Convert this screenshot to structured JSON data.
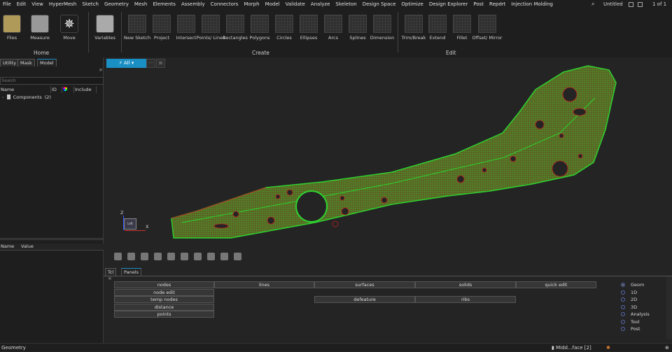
{
  "menu": [
    "File",
    "Edit",
    "View",
    "HyperMesh",
    "Sketch",
    "Geometry",
    "Mesh",
    "Elements",
    "Assembly",
    "Connectors",
    "Morph",
    "Model",
    "Validate",
    "Analyze",
    "Skeleton",
    "Design Space",
    "Optimize",
    "Design Explorer",
    "Post",
    "Report",
    "Injection Molding"
  ],
  "menu_active": "Sketch",
  "topright": {
    "doc": "Untitled",
    "page": "1 of 1"
  },
  "ribbon": {
    "home": {
      "files": "Files",
      "measure": "Measure",
      "move": "Move",
      "group": "Home"
    },
    "variables": "Variables",
    "create": {
      "items": [
        "New Sketch",
        "Project",
        "Intersect",
        "Points/ Lines",
        "Rectangles",
        "Polygons",
        "Circles",
        "Ellipses",
        "Arcs",
        "Splines",
        "Dimension"
      ],
      "group": "Create"
    },
    "edit": {
      "items": [
        "Trim/Break",
        "Extend",
        "Fillet",
        "Offset/ Mirror"
      ],
      "group": "Edit"
    }
  },
  "left": {
    "tabs": [
      "Utility",
      "Mask",
      "Model"
    ],
    "search_placeholder": "Search",
    "columns": [
      "Name",
      "ID",
      "",
      "Include"
    ],
    "tree": [
      {
        "label": "Components",
        "count": "(2)"
      }
    ],
    "props_columns": [
      "Name",
      "Value"
    ]
  },
  "filter": {
    "label": "All"
  },
  "axes": {
    "z": "Z",
    "x": "X",
    "cube": "Left"
  },
  "bottom": {
    "tabs": [
      "Tcl",
      "Panels"
    ],
    "panels": [
      [
        "nodes",
        "lines",
        "surfaces",
        "solids",
        "quick edit"
      ],
      [
        "node edit",
        "",
        "",
        "",
        ""
      ],
      [
        "temp nodes",
        "",
        "defeature",
        "ribs",
        ""
      ],
      [
        "distance",
        "",
        "",
        "",
        ""
      ],
      [
        "points",
        "",
        "",
        "",
        ""
      ]
    ],
    "radios": [
      "Geom",
      "1D",
      "2D",
      "3D",
      "Analysis",
      "Tool",
      "Post"
    ],
    "radio_selected": "Geom"
  },
  "status": {
    "left": "Geometry",
    "component": "Midd...face [2]"
  },
  "colors": {
    "accent": "#1a8fc4",
    "mesh_green": "#2fd12f",
    "mesh_fill": "#6b6b2a",
    "edge_red": "#c02020"
  }
}
